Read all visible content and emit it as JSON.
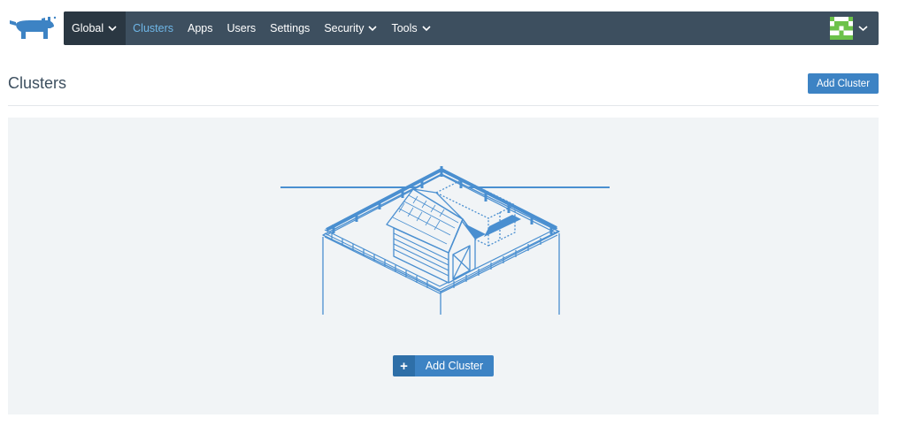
{
  "colors": {
    "nav_background": "#3d4f5f",
    "nav_active_section": "#2a3742",
    "nav_active_link": "#6fb7e8",
    "primary_button": "#3d83c4",
    "title_text": "#3d4f5f",
    "empty_panel": "#f1f4f6",
    "illustration_stroke": "#4a8fd0"
  },
  "logo": {
    "icon": "rancher-logo-icon"
  },
  "nav": {
    "global_label": "Global",
    "items": [
      {
        "label": "Clusters",
        "active": true
      },
      {
        "label": "Apps"
      },
      {
        "label": "Users"
      },
      {
        "label": "Settings"
      },
      {
        "label": "Security",
        "dropdown": true
      },
      {
        "label": "Tools",
        "dropdown": true
      }
    ]
  },
  "user_menu": {
    "avatar_icon": "avatar-identicon",
    "chevron_icon": "chevron-down-icon"
  },
  "page": {
    "title": "Clusters",
    "add_button": "Add Cluster"
  },
  "empty_state": {
    "illustration_icon": "barn-farm-illustration",
    "add_button_icon": "plus-icon",
    "add_button_icon_glyph": "+",
    "add_button": "Add Cluster"
  }
}
